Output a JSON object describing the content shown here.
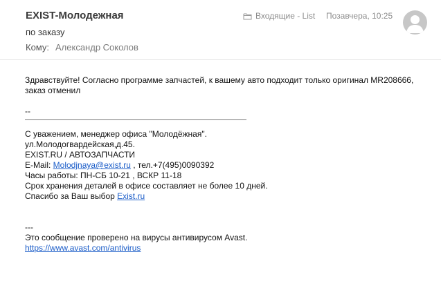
{
  "header": {
    "sender": "EXIST-Молодежная",
    "subject": "по заказу",
    "to_label": "Кому:",
    "to_name": "Александр Соколов",
    "folder": "Входящие - List",
    "date": "Позавчера, 10:25",
    "folder_icon": "folder-icon",
    "avatar_icon": "avatar-icon"
  },
  "body": {
    "greeting_line1": "Здравствуйте! Согласно программе запчастей, к вашему авто подходит только оригинал MR208666,",
    "greeting_line2": "заказ отменил",
    "dashes": "--",
    "sig_line1": "С уважением, менеджер офиса \"Молодёжная\".",
    "sig_line2": "ул.Молодогвардейская,д.45.",
    "sig_line3": "EXIST.RU / АВТОЗАПЧАСТИ",
    "email_prefix": "E-Mail: ",
    "email_link": "Molodjnaya@exist.ru",
    "email_suffix": " , тел.+7(495)0090392",
    "hours": "Часы работы: ПН-СБ 10-21 , ВСКР 11-18",
    "storage": "Срок хранения деталей в офисе составляет не более 10 дней.",
    "thanks_prefix": "Спасибо за Ваш выбор ",
    "thanks_link": "Exist.ru",
    "av_dashes": "---",
    "av_text": "Это сообщение проверено на вирусы антивирусом Avast.",
    "av_link": "https://www.avast.com/antivirus"
  }
}
